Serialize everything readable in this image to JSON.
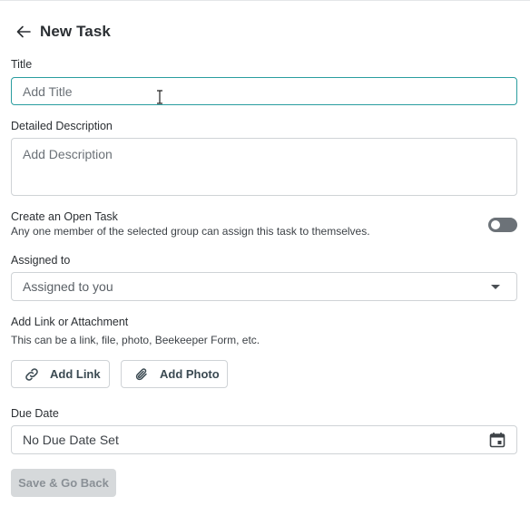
{
  "header": {
    "back_icon": "arrow-left-icon",
    "title": "New Task"
  },
  "form": {
    "title": {
      "label": "Title",
      "placeholder": "Add Title",
      "value": ""
    },
    "description": {
      "label": "Detailed Description",
      "placeholder": "Add Description",
      "value": ""
    },
    "open_task": {
      "label": "Create an Open Task",
      "helper": "Any one member of the selected group can assign this task to themselves.",
      "enabled": false
    },
    "assigned_to": {
      "label": "Assigned to",
      "selected": "Assigned to you",
      "icon": "chevron-down-icon"
    },
    "attachments": {
      "label": "Add Link or Attachment",
      "helper": "This can be a link, file, photo, Beekeeper Form, etc.",
      "add_link_label": "Add Link",
      "add_link_icon": "link-icon",
      "add_photo_label": "Add Photo",
      "add_photo_icon": "paperclip-icon"
    },
    "due_date": {
      "label": "Due Date",
      "value": "No Due Date Set",
      "icon": "calendar-icon"
    }
  },
  "actions": {
    "save_label": "Save & Go Back"
  },
  "colors": {
    "focus_border": "#2a9d9f",
    "toggle_off": "#6c7278",
    "disabled_button": "#d6d9db"
  }
}
